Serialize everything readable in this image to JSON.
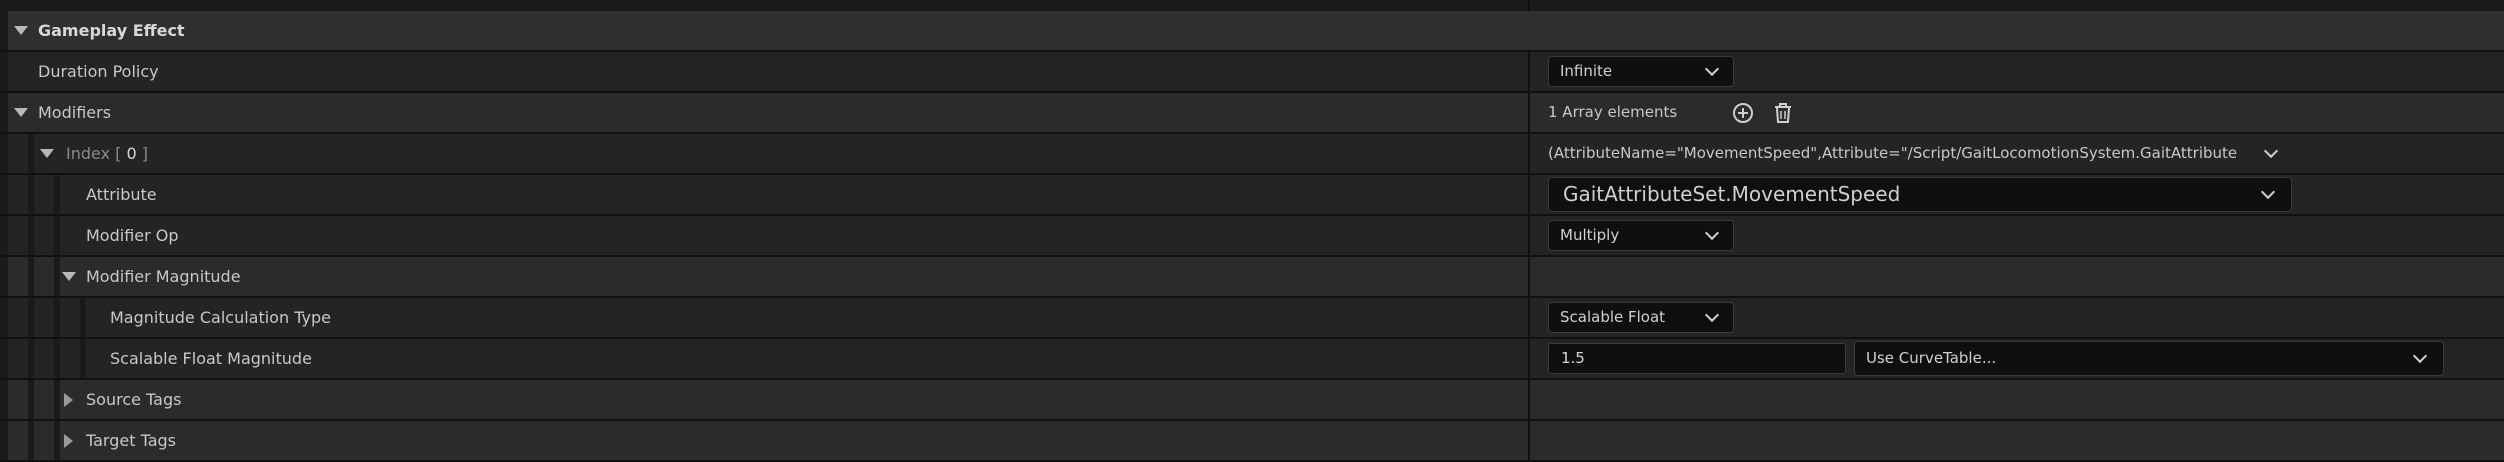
{
  "section": {
    "title": "Gameplay Effect"
  },
  "duration_policy": {
    "label": "Duration Policy",
    "value": "Infinite"
  },
  "modifiers": {
    "label": "Modifiers",
    "count_text": "1 Array elements",
    "add_icon": "plus-circle-icon",
    "delete_icon": "trash-icon"
  },
  "index": {
    "label_prefix": "Index [",
    "number": "0",
    "label_suffix": "]",
    "summary": "(AttributeName=\"MovementSpeed\",Attribute=\"/Script/GaitLocomotionSystem.GaitAttributeSet:Mo"
  },
  "attribute": {
    "label": "Attribute",
    "value": "GaitAttributeSet.MovementSpeed"
  },
  "modifier_op": {
    "label": "Modifier Op",
    "value": "Multiply"
  },
  "modifier_magnitude": {
    "label": "Modifier Magnitude"
  },
  "magnitude_calc_type": {
    "label": "Magnitude Calculation Type",
    "value": "Scalable Float"
  },
  "scalable_float": {
    "label": "Scalable Float Magnitude",
    "value": "1.5",
    "curve_table": "Use CurveTable..."
  },
  "source_tags": {
    "label": "Source Tags"
  },
  "target_tags": {
    "label": "Target Tags"
  },
  "colors": {
    "background": "#151515",
    "row": "#242424",
    "header_row": "#2f2f2f",
    "input": "#0f0f0f",
    "text": "#c8c8c8"
  }
}
